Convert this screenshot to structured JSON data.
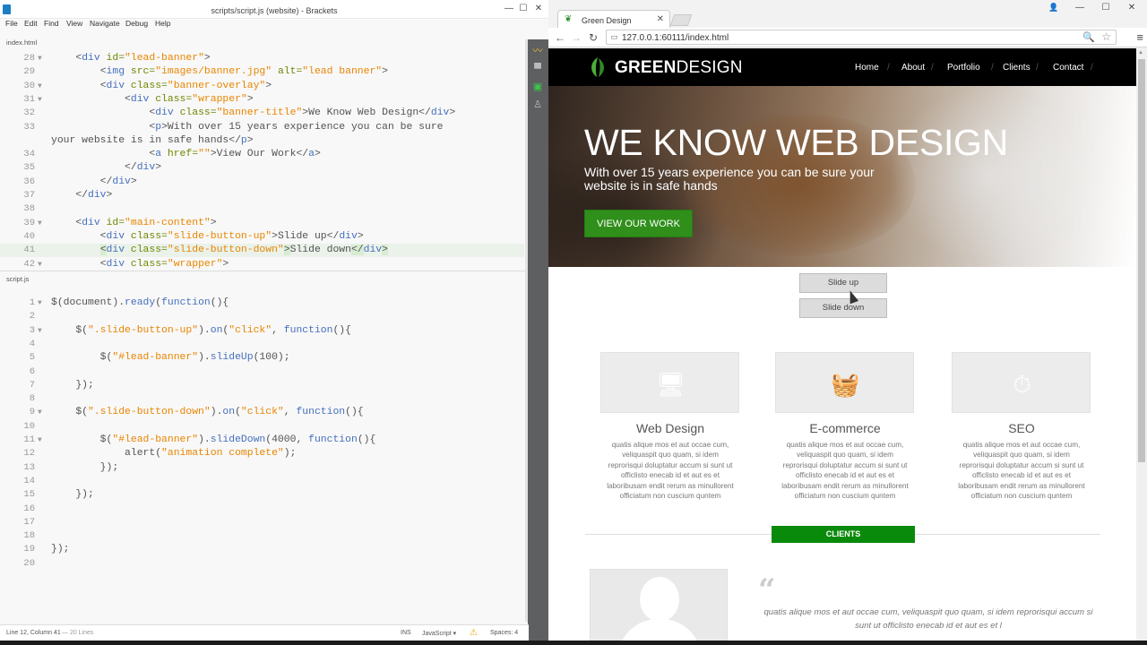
{
  "brackets": {
    "window_title": "scripts/script.js (website) - Brackets",
    "menu": [
      "File",
      "Edit",
      "Find",
      "View",
      "Navigate",
      "Debug",
      "Help"
    ],
    "top_file": "index.html",
    "bottom_file": "script.js",
    "html_lines": [
      {
        "n": "28",
        "fold": "▼",
        "segs": [
          [
            "p",
            "    "
          ],
          [
            "p",
            "<"
          ],
          [
            "tg",
            "div "
          ],
          [
            "at",
            "id="
          ],
          [
            "st",
            "\"lead-banner\""
          ],
          [
            "p",
            ">"
          ]
        ]
      },
      {
        "n": "29",
        "fold": "",
        "segs": [
          [
            "p",
            "        "
          ],
          [
            "p",
            "<"
          ],
          [
            "tg",
            "img "
          ],
          [
            "at",
            "src="
          ],
          [
            "st",
            "\"images/banner.jpg\" "
          ],
          [
            "at",
            "alt="
          ],
          [
            "st",
            "\"lead banner\""
          ],
          [
            "p",
            ">"
          ]
        ]
      },
      {
        "n": "30",
        "fold": "▼",
        "segs": [
          [
            "p",
            "        "
          ],
          [
            "p",
            "<"
          ],
          [
            "tg",
            "div "
          ],
          [
            "at",
            "class="
          ],
          [
            "st",
            "\"banner-overlay\""
          ],
          [
            "p",
            ">"
          ]
        ]
      },
      {
        "n": "31",
        "fold": "▼",
        "segs": [
          [
            "p",
            "            "
          ],
          [
            "p",
            "<"
          ],
          [
            "tg",
            "div "
          ],
          [
            "at",
            "class="
          ],
          [
            "st",
            "\"wrapper\""
          ],
          [
            "p",
            ">"
          ]
        ]
      },
      {
        "n": "32",
        "fold": "",
        "segs": [
          [
            "p",
            "                "
          ],
          [
            "p",
            "<"
          ],
          [
            "tg",
            "div "
          ],
          [
            "at",
            "class="
          ],
          [
            "st",
            "\"banner-title\""
          ],
          [
            "p",
            ">We Know Web Design</"
          ],
          [
            "tg",
            "div"
          ],
          [
            "p",
            ">"
          ]
        ]
      },
      {
        "n": "33",
        "fold": "",
        "segs": [
          [
            "p",
            "                "
          ],
          [
            "p",
            "<"
          ],
          [
            "tg",
            "p"
          ],
          [
            "p",
            ">With over 15 years experience you can be sure"
          ]
        ]
      },
      {
        "n": "",
        "fold": "",
        "segs": [
          [
            "p",
            "your website is in safe hands</"
          ],
          [
            "tg",
            "p"
          ],
          [
            "p",
            ">"
          ]
        ]
      },
      {
        "n": "34",
        "fold": "",
        "segs": [
          [
            "p",
            "                "
          ],
          [
            "p",
            "<"
          ],
          [
            "tg",
            "a "
          ],
          [
            "at",
            "href="
          ],
          [
            "st",
            "\"\""
          ],
          [
            "p",
            ">View Our Work</"
          ],
          [
            "tg",
            "a"
          ],
          [
            "p",
            ">"
          ]
        ]
      },
      {
        "n": "35",
        "fold": "",
        "segs": [
          [
            "p",
            "            </"
          ],
          [
            "tg",
            "div"
          ],
          [
            "p",
            ">"
          ]
        ]
      },
      {
        "n": "36",
        "fold": "",
        "segs": [
          [
            "p",
            "        </"
          ],
          [
            "tg",
            "div"
          ],
          [
            "p",
            ">"
          ]
        ]
      },
      {
        "n": "37",
        "fold": "",
        "segs": [
          [
            "p",
            "    </"
          ],
          [
            "tg",
            "div"
          ],
          [
            "p",
            ">"
          ]
        ]
      },
      {
        "n": "38",
        "fold": "",
        "segs": [
          [
            "p",
            ""
          ]
        ]
      },
      {
        "n": "39",
        "fold": "▼",
        "segs": [
          [
            "p",
            "    <"
          ],
          [
            "tg",
            "div "
          ],
          [
            "at",
            "id="
          ],
          [
            "st",
            "\"main-content\""
          ],
          [
            "p",
            ">"
          ]
        ]
      },
      {
        "n": "40",
        "fold": "",
        "segs": [
          [
            "p",
            "        <"
          ],
          [
            "tg",
            "div "
          ],
          [
            "at",
            "class="
          ],
          [
            "st",
            "\"slide-button-up\""
          ],
          [
            "p",
            ">Slide up</"
          ],
          [
            "tg",
            "div"
          ],
          [
            "p",
            ">"
          ]
        ]
      },
      {
        "n": "41",
        "fold": "",
        "hl": true,
        "segs": [
          [
            "p",
            "        "
          ],
          [
            "hx",
            "<"
          ],
          [
            "tg",
            "div "
          ],
          [
            "at",
            "class="
          ],
          [
            "st",
            "\"slide-button-down\""
          ],
          [
            "hx",
            ">"
          ],
          [
            "p",
            "Slide down"
          ],
          [
            "hx",
            "</"
          ],
          [
            "tg",
            "div"
          ],
          [
            "hx",
            ">"
          ]
        ]
      },
      {
        "n": "42",
        "fold": "▼",
        "segs": [
          [
            "p",
            "        <"
          ],
          [
            "tg",
            "div "
          ],
          [
            "at",
            "class="
          ],
          [
            "st",
            "\"wrapper\""
          ],
          [
            "p",
            ">"
          ]
        ]
      }
    ],
    "js_lines": [
      {
        "n": "1",
        "fold": "▼",
        "segs": [
          [
            "p",
            "$(document)."
          ],
          [
            "fn",
            "ready"
          ],
          [
            "p",
            "("
          ],
          [
            "fn",
            "function"
          ],
          [
            "p",
            "(){"
          ]
        ]
      },
      {
        "n": "2",
        "fold": "",
        "segs": [
          [
            "p",
            ""
          ]
        ]
      },
      {
        "n": "3",
        "fold": "▼",
        "segs": [
          [
            "p",
            "    $("
          ],
          [
            "st",
            "\".slide-button-up\""
          ],
          [
            "p",
            ")."
          ],
          [
            "fn",
            "on"
          ],
          [
            "p",
            "("
          ],
          [
            "st",
            "\"click\""
          ],
          [
            "p",
            ", "
          ],
          [
            "fn",
            "function"
          ],
          [
            "p",
            "(){"
          ]
        ]
      },
      {
        "n": "4",
        "fold": "",
        "segs": [
          [
            "p",
            ""
          ]
        ]
      },
      {
        "n": "5",
        "fold": "",
        "segs": [
          [
            "p",
            "        $("
          ],
          [
            "st",
            "\"#lead-banner\""
          ],
          [
            "p",
            ")."
          ],
          [
            "fn",
            "slideUp"
          ],
          [
            "p",
            "(100);"
          ]
        ]
      },
      {
        "n": "6",
        "fold": "",
        "segs": [
          [
            "p",
            ""
          ]
        ]
      },
      {
        "n": "7",
        "fold": "",
        "segs": [
          [
            "p",
            "    });"
          ]
        ]
      },
      {
        "n": "8",
        "fold": "",
        "segs": [
          [
            "p",
            ""
          ]
        ]
      },
      {
        "n": "9",
        "fold": "▼",
        "segs": [
          [
            "p",
            "    $("
          ],
          [
            "st",
            "\".slide-button-down\""
          ],
          [
            "p",
            ")."
          ],
          [
            "fn",
            "on"
          ],
          [
            "p",
            "("
          ],
          [
            "st",
            "\"click\""
          ],
          [
            "p",
            ", "
          ],
          [
            "fn",
            "function"
          ],
          [
            "p",
            "(){"
          ]
        ]
      },
      {
        "n": "10",
        "fold": "",
        "segs": [
          [
            "p",
            ""
          ]
        ]
      },
      {
        "n": "11",
        "fold": "▼",
        "segs": [
          [
            "p",
            "        $("
          ],
          [
            "st",
            "\"#lead-banner\""
          ],
          [
            "p",
            ")."
          ],
          [
            "fn",
            "slideDown"
          ],
          [
            "p",
            "(4000, "
          ],
          [
            "fn",
            "function"
          ],
          [
            "p",
            "(){"
          ]
        ]
      },
      {
        "n": "12",
        "fold": "",
        "segs": [
          [
            "p",
            "            alert("
          ],
          [
            "st",
            "\"animation complete\""
          ],
          [
            "p",
            ");"
          ]
        ]
      },
      {
        "n": "13",
        "fold": "",
        "segs": [
          [
            "p",
            "        });"
          ]
        ]
      },
      {
        "n": "14",
        "fold": "",
        "segs": [
          [
            "p",
            ""
          ]
        ]
      },
      {
        "n": "15",
        "fold": "",
        "segs": [
          [
            "p",
            "    });"
          ]
        ]
      },
      {
        "n": "16",
        "fold": "",
        "segs": [
          [
            "p",
            ""
          ]
        ]
      },
      {
        "n": "17",
        "fold": "",
        "segs": [
          [
            "p",
            ""
          ]
        ]
      },
      {
        "n": "18",
        "fold": "",
        "segs": [
          [
            "p",
            ""
          ]
        ]
      },
      {
        "n": "19",
        "fold": "",
        "segs": [
          [
            "p",
            "});"
          ]
        ]
      },
      {
        "n": "20",
        "fold": "",
        "segs": [
          [
            "p",
            ""
          ]
        ]
      }
    ],
    "status": {
      "cursor": "Line 12, Column 41",
      "lines": "— 20 Lines",
      "ins": "INS",
      "lang": "JavaScript",
      "lang_arrow": "▾",
      "warn_icon": "⚠",
      "spaces": "Spaces: 4"
    },
    "window_buttons": [
      "—",
      "☐",
      "✕"
    ],
    "colors": {
      "tag": "#446fbd",
      "attr": "#6d8600",
      "string": "#e88501",
      "sidebar": "#5d5f60"
    }
  },
  "chrome": {
    "tab_title": "Green Design",
    "tab_close": "✕",
    "url": "127.0.0.1:60111/index.html",
    "window_buttons": [
      "—",
      "☐",
      "✕"
    ],
    "user_icon": "👤",
    "nav_back": "←",
    "nav_forward": "→",
    "nav_reload": "↻",
    "zoom_icon": "🔍",
    "star_icon": "☆",
    "menu_icon": "≡"
  },
  "site": {
    "brand_bold": "GREEN",
    "brand_light": "DESIGN",
    "nav": [
      "Home",
      "About",
      "Portfolio",
      "Clients",
      "Contact"
    ],
    "nav_sep": "/",
    "banner_title": "WE KNOW WEB DESIGN",
    "banner_text": "With over 15 years experience you can be sure your website is in safe hands",
    "banner_button": "VIEW OUR WORK",
    "slide_up": "Slide up",
    "slide_down": "Slide down",
    "services": [
      {
        "icon": "🖥",
        "title": "Web Design",
        "text": "quatis alique mos et aut occae cum, veliquaspit quo quam, si idem reprorisqui doluptatur accum si sunt ut officlisto enecab id et aut es et laboribusam endit rerum as minullorent officiatum non cuscium quntem"
      },
      {
        "icon": "🧺",
        "title": "E-commerce",
        "text": "quatis alique mos et aut occae cum, veliquaspit quo quam, si idem reprorisqui doluptatur accum si sunt ut officlisto enecab id et aut es et laboribusam endit rerum as minullorent officiatum non cuscium quntem"
      },
      {
        "icon": "⏱",
        "title": "SEO",
        "text": "quatis alique mos et aut occae cum, veliquaspit quo quam, si idem reprorisqui doluptatur accum si sunt ut officlisto enecab id et aut es et laboribusam endit rerum as minullorent officiatum non cuscium quntem"
      }
    ],
    "clients_label": "CLIENTS",
    "quote_mark": "“",
    "quote": "quatis alique mos et aut occae cum, veliquaspit quo quam, si idem reprorisqui accum si sunt ut officlisto enecab id et aut es et l",
    "colors": {
      "green": "#2f8f1a",
      "clients_green": "#0a8a0a",
      "header": "#000000"
    }
  }
}
